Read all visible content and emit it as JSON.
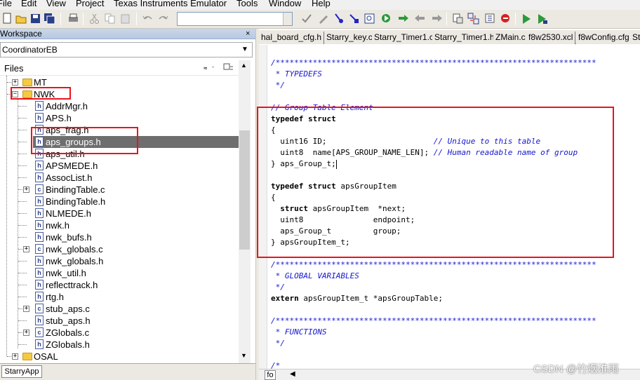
{
  "menu": [
    "File",
    "Edit",
    "View",
    "Project",
    "Texas Instruments Emulator",
    "Tools",
    "Window",
    "Help"
  ],
  "workspace": {
    "title": "Workspace",
    "close_glyph": "×",
    "config": "CoordinatorEB",
    "files_header": "Files",
    "bottom_tab": "StarryApp"
  },
  "tree": [
    {
      "label": "MT",
      "kind": "folder",
      "expander": "+"
    },
    {
      "label": "NWK",
      "kind": "folder",
      "expander": "−"
    },
    {
      "label": "AddrMgr.h",
      "kind": "h"
    },
    {
      "label": "APS.h",
      "kind": "h"
    },
    {
      "label": "aps_frag.h",
      "kind": "h"
    },
    {
      "label": "aps_groups.h",
      "kind": "h",
      "selected": true
    },
    {
      "label": "aps_util.h",
      "kind": "h"
    },
    {
      "label": "APSMEDE.h",
      "kind": "h"
    },
    {
      "label": "AssocList.h",
      "kind": "h"
    },
    {
      "label": "BindingTable.c",
      "kind": "c",
      "expander": "+"
    },
    {
      "label": "BindingTable.h",
      "kind": "h"
    },
    {
      "label": "NLMEDE.h",
      "kind": "h"
    },
    {
      "label": "nwk.h",
      "kind": "h"
    },
    {
      "label": "nwk_bufs.h",
      "kind": "h"
    },
    {
      "label": "nwk_globals.c",
      "kind": "c",
      "expander": "+"
    },
    {
      "label": "nwk_globals.h",
      "kind": "h"
    },
    {
      "label": "nwk_util.h",
      "kind": "h"
    },
    {
      "label": "reflecttrack.h",
      "kind": "h"
    },
    {
      "label": "rtg.h",
      "kind": "h"
    },
    {
      "label": "stub_aps.c",
      "kind": "c",
      "expander": "+"
    },
    {
      "label": "stub_aps.h",
      "kind": "h"
    },
    {
      "label": "ZGlobals.c",
      "kind": "c",
      "expander": "+"
    },
    {
      "label": "ZGlobals.h",
      "kind": "h"
    },
    {
      "label": "OSAL",
      "kind": "folder",
      "expander": "+"
    }
  ],
  "editor_tabs": [
    "hal_board_cfg.h",
    "Starry_key.c",
    "Starry_Timer1.c",
    "Starry_Timer1.h",
    "ZMain.c",
    "f8w2530.xcl",
    "f8wConfig.cfg",
    "St"
  ],
  "code_lines": [
    [
      {
        "t": "/*********************************************************************",
        "c": "cm"
      }
    ],
    [
      {
        "t": " * TYPEDEFS",
        "c": "cm"
      }
    ],
    [
      {
        "t": " */",
        "c": "cm"
      }
    ],
    [
      {
        "t": "",
        "c": ""
      }
    ],
    [
      {
        "t": "// Group Table Element",
        "c": "cm"
      }
    ],
    [
      {
        "t": "typedef struct",
        "c": "kw"
      }
    ],
    [
      {
        "t": "{",
        "c": ""
      }
    ],
    [
      {
        "t": "  uint16 ID;                       ",
        "c": ""
      },
      {
        "t": "// Unique to this table",
        "c": "cm"
      }
    ],
    [
      {
        "t": "  uint8  name[APS_GROUP_NAME_LEN]; ",
        "c": ""
      },
      {
        "t": "// Human readable name of group",
        "c": "cm"
      }
    ],
    [
      {
        "t": "} aps_Group_t;",
        "c": ""
      }
    ],
    [
      {
        "t": "",
        "c": ""
      }
    ],
    [
      {
        "t": "typedef struct",
        "c": "kw"
      },
      {
        "t": " apsGroupItem",
        "c": ""
      }
    ],
    [
      {
        "t": "{",
        "c": ""
      }
    ],
    [
      {
        "t": "  ",
        "c": ""
      },
      {
        "t": "struct",
        "c": "kw"
      },
      {
        "t": " apsGroupItem  *next;",
        "c": ""
      }
    ],
    [
      {
        "t": "  uint8               endpoint;",
        "c": ""
      }
    ],
    [
      {
        "t": "  aps_Group_t         group;",
        "c": ""
      }
    ],
    [
      {
        "t": "} apsGroupItem_t;",
        "c": ""
      }
    ],
    [
      {
        "t": "",
        "c": ""
      }
    ],
    [
      {
        "t": "/*********************************************************************",
        "c": "cm"
      }
    ],
    [
      {
        "t": " * GLOBAL VARIABLES",
        "c": "cm"
      }
    ],
    [
      {
        "t": " */",
        "c": "cm"
      }
    ],
    [
      {
        "t": "extern",
        "c": "kw"
      },
      {
        "t": " apsGroupItem_t *apsGroupTable;",
        "c": ""
      }
    ],
    [
      {
        "t": "",
        "c": ""
      }
    ],
    [
      {
        "t": "/*********************************************************************",
        "c": "cm"
      }
    ],
    [
      {
        "t": " * FUNCTIONS",
        "c": "cm"
      }
    ],
    [
      {
        "t": " */",
        "c": "cm"
      }
    ],
    [
      {
        "t": "",
        "c": ""
      }
    ],
    [
      {
        "t": "/*",
        "c": "cm"
      }
    ]
  ],
  "status": {
    "fo": "fo"
  },
  "watermark": "CSDN @竹烟淮雨",
  "colors": {
    "annotation": "#e8141e",
    "comment": "#1515d0",
    "selection": "#6e6e6e"
  }
}
